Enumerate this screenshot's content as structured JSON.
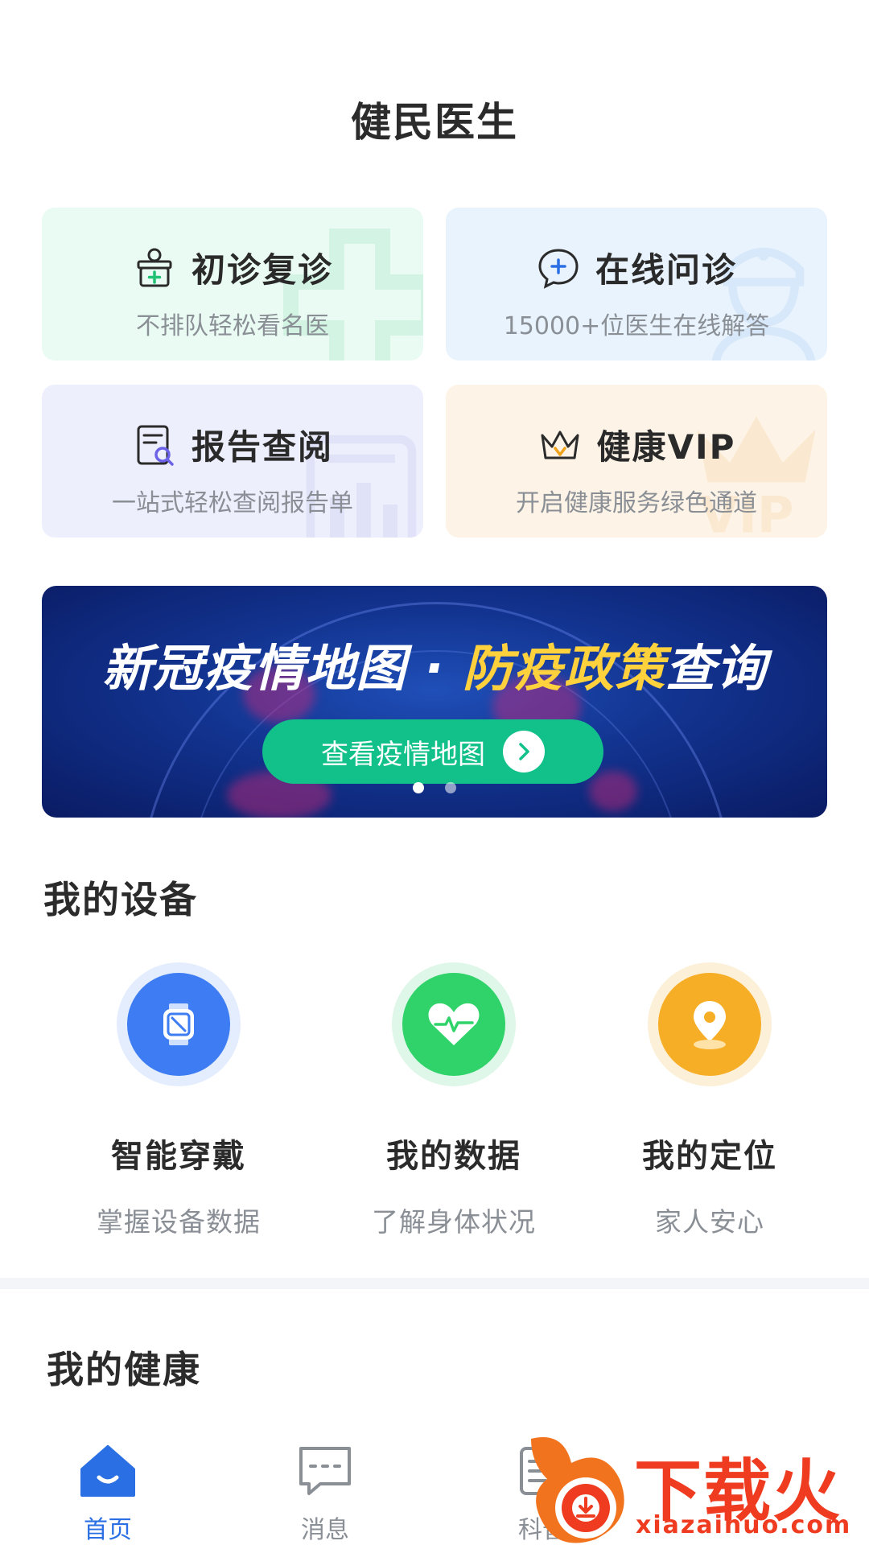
{
  "app": {
    "title": "健民医生"
  },
  "services": [
    {
      "title": "初诊复诊",
      "subtitle": "不排队轻松看名医",
      "icon": "clinic-bag-icon"
    },
    {
      "title": "在线问诊",
      "subtitle": "15000+位医生在线解答",
      "icon": "chat-plus-icon"
    },
    {
      "title": "报告查阅",
      "subtitle": "一站式轻松查阅报告单",
      "icon": "report-search-icon"
    },
    {
      "title": "健康VIP",
      "subtitle": "开启健康服务绿色通道",
      "icon": "crown-icon"
    }
  ],
  "banner": {
    "headline_main": "新冠疫情地图 · ",
    "headline_highlight": "防疫政策",
    "headline_tail": "查询",
    "button_label": "查看疫情地图",
    "pages": 2,
    "active_page": 1
  },
  "devices_section": {
    "title": "我的设备",
    "items": [
      {
        "name": "智能穿戴",
        "desc": "掌握设备数据",
        "icon": "smartwatch-icon",
        "color": "#3d7cf2"
      },
      {
        "name": "我的数据",
        "desc": "了解身体状况",
        "icon": "heart-pulse-icon",
        "color": "#2fd36a"
      },
      {
        "name": "我的定位",
        "desc": "家人安心",
        "icon": "location-pin-icon",
        "color": "#f7ae27"
      }
    ]
  },
  "health_section": {
    "title": "我的健康"
  },
  "tabbar": {
    "items": [
      {
        "label": "首页",
        "icon": "home-icon",
        "active": true
      },
      {
        "label": "消息",
        "icon": "message-icon",
        "active": false
      },
      {
        "label": "科普",
        "icon": "science-icon",
        "active": false
      }
    ]
  },
  "watermark": {
    "text": "下载火",
    "url": "xiazaihuo.com"
  },
  "colors": {
    "accent": "#2a6fe3",
    "cta": "#12c08a",
    "highlight": "#ffd13d"
  }
}
